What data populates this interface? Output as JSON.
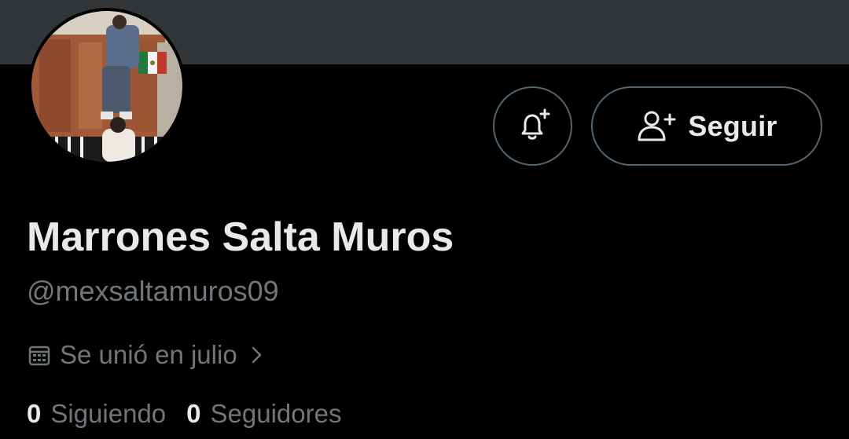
{
  "profile": {
    "display_name": "Marrones Salta Muros",
    "handle": "@mexsaltamuros09",
    "joined": "Se unió en julio",
    "following_count": "0",
    "following_label": "Siguiendo",
    "followers_count": "0",
    "followers_label": "Seguidores"
  },
  "actions": {
    "follow_label": "Seguir",
    "notify_icon": "bell-plus-icon",
    "follow_icon": "person-add-icon"
  },
  "icons": {
    "calendar": "calendar-icon",
    "chevron": "chevron-right-icon"
  },
  "colors": {
    "background": "#000000",
    "banner": "#333639",
    "primary_text": "#e7e9ea",
    "secondary_text": "#71767b",
    "button_border": "#536471"
  }
}
